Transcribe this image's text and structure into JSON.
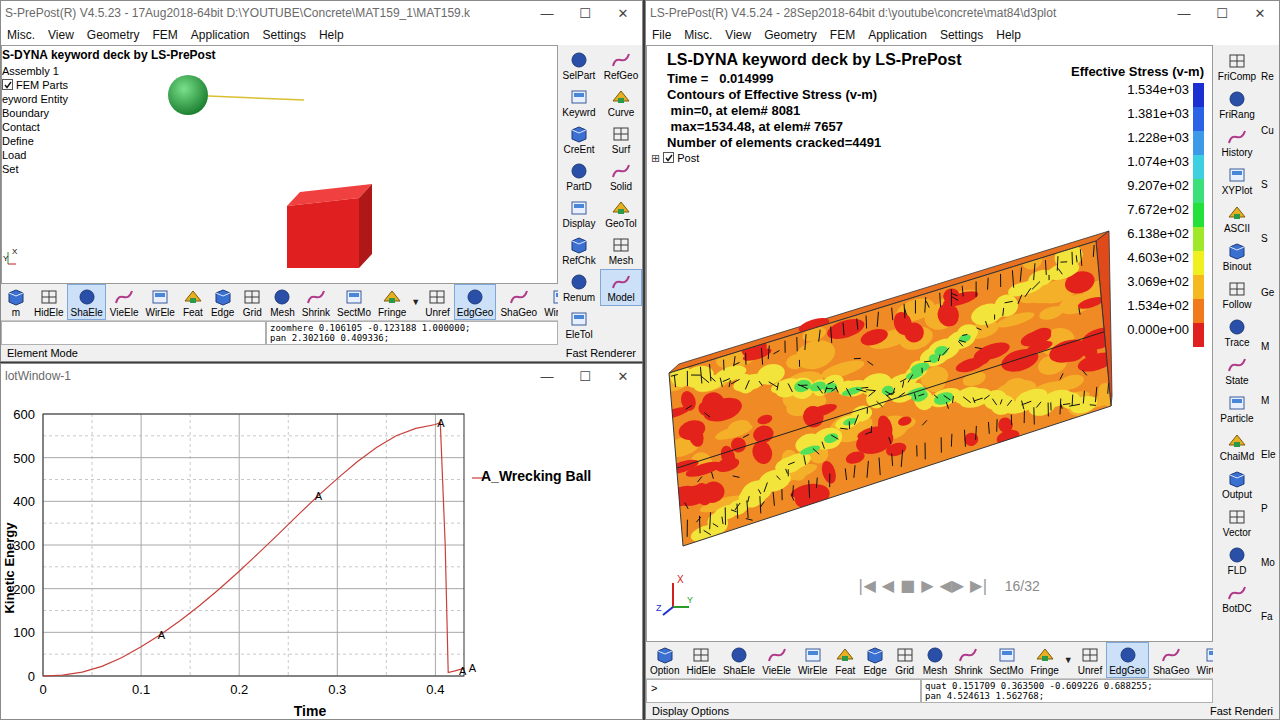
{
  "model_window": {
    "title": "S-PrePost(R) V4.5.23 - 17Aug2018-64bit D:\\YOUTUBE\\Concrete\\MAT159_1\\MAT159.k",
    "controls": [
      "—",
      "☐",
      "✕"
    ],
    "menu": [
      "Misc.",
      "View",
      "Geometry",
      "FEM",
      "Application",
      "Settings",
      "Help"
    ],
    "canvas": {
      "heading": "S-DYNA keyword deck by LS-PrePost",
      "triad": [
        "Y",
        "X"
      ]
    },
    "tree": [
      {
        "label": "Assembly 1",
        "kind": "plain"
      },
      {
        "label": "FEM Parts",
        "kind": "check",
        "checked": true
      },
      {
        "label": "eyword Entity",
        "kind": "plain"
      },
      {
        "label": "Boundary",
        "kind": "plain"
      },
      {
        "label": "Contact",
        "kind": "plain"
      },
      {
        "label": "Define",
        "kind": "plain"
      },
      {
        "label": "Load",
        "kind": "plain"
      },
      {
        "label": "Set",
        "kind": "plain"
      }
    ],
    "side_tools": [
      {
        "label": "SelPart",
        "selected": false
      },
      {
        "label": "RefGeo",
        "selected": false
      },
      {
        "label": "Keywrd",
        "selected": false
      },
      {
        "label": "Curve",
        "selected": false
      },
      {
        "label": "CreEnt",
        "selected": false
      },
      {
        "label": "Surf",
        "selected": false
      },
      {
        "label": "PartD",
        "selected": false
      },
      {
        "label": "Solid",
        "selected": false
      },
      {
        "label": "Display",
        "selected": false
      },
      {
        "label": "GeoTol",
        "selected": false
      },
      {
        "label": "RefChk",
        "selected": false
      },
      {
        "label": "Mesh",
        "selected": false
      },
      {
        "label": "Renum",
        "selected": false
      },
      {
        "label": "Model",
        "selected": true
      },
      {
        "label": "EleTol",
        "selected": false
      }
    ],
    "bottom_tools": [
      {
        "label": "m",
        "kind": "tool",
        "selected": false
      },
      {
        "label": "HidEle",
        "kind": "tool",
        "selected": false
      },
      {
        "label": "ShaEle",
        "kind": "tool",
        "selected": true
      },
      {
        "label": "VieEle",
        "kind": "tool",
        "selected": false
      },
      {
        "label": "WirEle",
        "kind": "tool",
        "selected": false
      },
      {
        "label": "Feat",
        "kind": "tool",
        "selected": false
      },
      {
        "label": "Edge",
        "kind": "tool",
        "selected": false
      },
      {
        "label": "Grid",
        "kind": "tool",
        "selected": false
      },
      {
        "label": "Mesh",
        "kind": "tool",
        "selected": false
      },
      {
        "label": "Shrink",
        "kind": "tool",
        "selected": false
      },
      {
        "label": "SectMo",
        "kind": "tool",
        "selected": false
      },
      {
        "label": "Fringe",
        "kind": "tool",
        "selected": false
      },
      {
        "label": "▼",
        "kind": "arrow",
        "selected": false
      },
      {
        "label": "Unref",
        "kind": "tool",
        "selected": false
      },
      {
        "label": "EdgGeo",
        "kind": "tool",
        "selected": true
      },
      {
        "label": "ShaGeo",
        "kind": "tool",
        "selected": false
      },
      {
        "label": "WirGeo",
        "kind": "tool",
        "selected": false
      }
    ],
    "prompt": "",
    "command_lines": [
      "zoomhere 0.106105 -0.123188 1.000000;",
      "pan 2.302160 0.409336;"
    ],
    "status": {
      "left": "Element Mode",
      "right": "Fast Renderer"
    }
  },
  "plot_window": {
    "title": "lotWindow-1",
    "controls": [
      "—",
      "☐",
      "✕"
    ],
    "chart": {
      "x_label": "Time",
      "y_label": "Kinetic Energy",
      "x_ticks": [
        "0",
        "0.1",
        "0.2",
        "0.3",
        "0.4"
      ],
      "y_ticks": [
        "0",
        "100",
        "200",
        "300",
        "400",
        "500",
        "600"
      ],
      "legend": "A_Wrecking Ball",
      "series": [
        {
          "name": "Wrecking Ball",
          "color": "#c8403c",
          "times": [
            0,
            0.02,
            0.04,
            0.06,
            0.08,
            0.1,
            0.12,
            0.14,
            0.16,
            0.18,
            0.2,
            0.22,
            0.24,
            0.26,
            0.28,
            0.3,
            0.32,
            0.34,
            0.36,
            0.38,
            0.4,
            0.405,
            0.41,
            0.413,
            0.42,
            0.43
          ],
          "values": [
            0,
            2,
            9,
            22,
            42,
            67,
            95,
            127,
            162,
            200,
            240,
            282,
            325,
            369,
            412,
            452,
            490,
            523,
            550,
            567,
            576,
            580,
            300,
            8,
            12,
            18
          ],
          "markers": [
            {
              "label": "A",
              "index": 6
            },
            {
              "label": "A",
              "index": 14
            },
            {
              "label": "A",
              "index": 21
            },
            {
              "label": "A",
              "index": 24
            },
            {
              "label": "A",
              "index": 25
            }
          ]
        }
      ]
    }
  },
  "post_window": {
    "title": "LS-PrePost(R) V4.5.24 - 28Sep2018-64bit d:\\youtube\\concrete\\mat84\\d3plot",
    "controls": [
      "—",
      "☐",
      "✕"
    ],
    "menu": [
      "File",
      "Misc.",
      "View",
      "Geometry",
      "FEM",
      "Application",
      "Settings",
      "Help"
    ],
    "info": {
      "heading": "LS-DYNA keyword deck by LS-PrePost",
      "lines": [
        "Time =   0.014999",
        "Contours of Effective Stress (v-m)",
        " min=0, at elem# 8081",
        " max=1534.48, at elem# 7657",
        "Number of elements cracked=4491"
      ]
    },
    "tree": [
      {
        "expander": "⊞",
        "label": "Post",
        "checked": true
      }
    ],
    "legend": {
      "title": "Effective Stress (v-m)",
      "entries": [
        {
          "label": "1.534e+03",
          "color": "#1c2fd0"
        },
        {
          "label": "1.381e+03",
          "color": "#2c62e6"
        },
        {
          "label": "1.228e+03",
          "color": "#3d9ae8"
        },
        {
          "label": "1.074e+03",
          "color": "#3ed0e0"
        },
        {
          "label": "9.207e+02",
          "color": "#3ce07a"
        },
        {
          "label": "7.672e+02",
          "color": "#24e03a"
        },
        {
          "label": "6.138e+02",
          "color": "#a0e82a"
        },
        {
          "label": "4.603e+02",
          "color": "#f0f020"
        },
        {
          "label": "3.069e+02",
          "color": "#f5b820"
        },
        {
          "label": "1.534e+02",
          "color": "#f07a1c"
        },
        {
          "label": "0.000e+00",
          "color": "#e02020"
        }
      ]
    },
    "playback": {
      "buttons": [
        "|◀",
        "◀",
        "■",
        "▶",
        "◀▶",
        "▶|"
      ],
      "frame": "16/32"
    },
    "triad": [
      "X",
      "Y",
      "Z"
    ],
    "side_tools": [
      {
        "label": "FriComp",
        "selected": false
      },
      {
        "label": "FriRang",
        "selected": false
      },
      {
        "label": "History",
        "selected": false
      },
      {
        "label": "XYPlot",
        "selected": false
      },
      {
        "label": "ASCII",
        "selected": false
      },
      {
        "label": "Binout",
        "selected": false
      },
      {
        "label": "Follow",
        "selected": false
      },
      {
        "label": "Trace",
        "selected": false
      },
      {
        "label": "State",
        "selected": false
      },
      {
        "label": "Particle",
        "selected": false
      },
      {
        "label": "ChaiMd",
        "selected": false
      },
      {
        "label": "Output",
        "selected": false
      },
      {
        "label": "Vector",
        "selected": false
      },
      {
        "label": "FLD",
        "selected": false
      },
      {
        "label": "BotDC",
        "selected": false
      }
    ],
    "cut_tools": [
      "Re",
      "Cu",
      "S",
      "S",
      "Ge",
      "M",
      "M",
      "Ele",
      "P",
      "Mo",
      "Fa"
    ],
    "bottom_tools": [
      {
        "label": "Option",
        "kind": "tool",
        "selected": false
      },
      {
        "label": "HidEle",
        "kind": "tool",
        "selected": false
      },
      {
        "label": "ShaEle",
        "kind": "tool",
        "selected": false
      },
      {
        "label": "VieEle",
        "kind": "tool",
        "selected": false
      },
      {
        "label": "WirEle",
        "kind": "tool",
        "selected": false
      },
      {
        "label": "Feat",
        "kind": "tool",
        "selected": false
      },
      {
        "label": "Edge",
        "kind": "tool",
        "selected": false
      },
      {
        "label": "Grid",
        "kind": "tool",
        "selected": false
      },
      {
        "label": "Mesh",
        "kind": "tool",
        "selected": false
      },
      {
        "label": "Shrink",
        "kind": "tool",
        "selected": false
      },
      {
        "label": "SectMo",
        "kind": "tool",
        "selected": false
      },
      {
        "label": "Fringe",
        "kind": "tool",
        "selected": false
      },
      {
        "label": "▼",
        "kind": "arrow",
        "selected": false
      },
      {
        "label": "Unref",
        "kind": "tool",
        "selected": false
      },
      {
        "label": "EdgGeo",
        "kind": "tool",
        "selected": true
      },
      {
        "label": "ShaGeo",
        "kind": "tool",
        "selected": false
      },
      {
        "label": "WirGeo",
        "kind": "tool",
        "selected": false
      }
    ],
    "prompt": ">",
    "command_lines": [
      "quat 0.151709 0.363500 -0.609226 0.688255;",
      "pan 4.524613 1.562768;"
    ],
    "status": {
      "left": "Display Options",
      "right": "Fast Renderi"
    }
  }
}
